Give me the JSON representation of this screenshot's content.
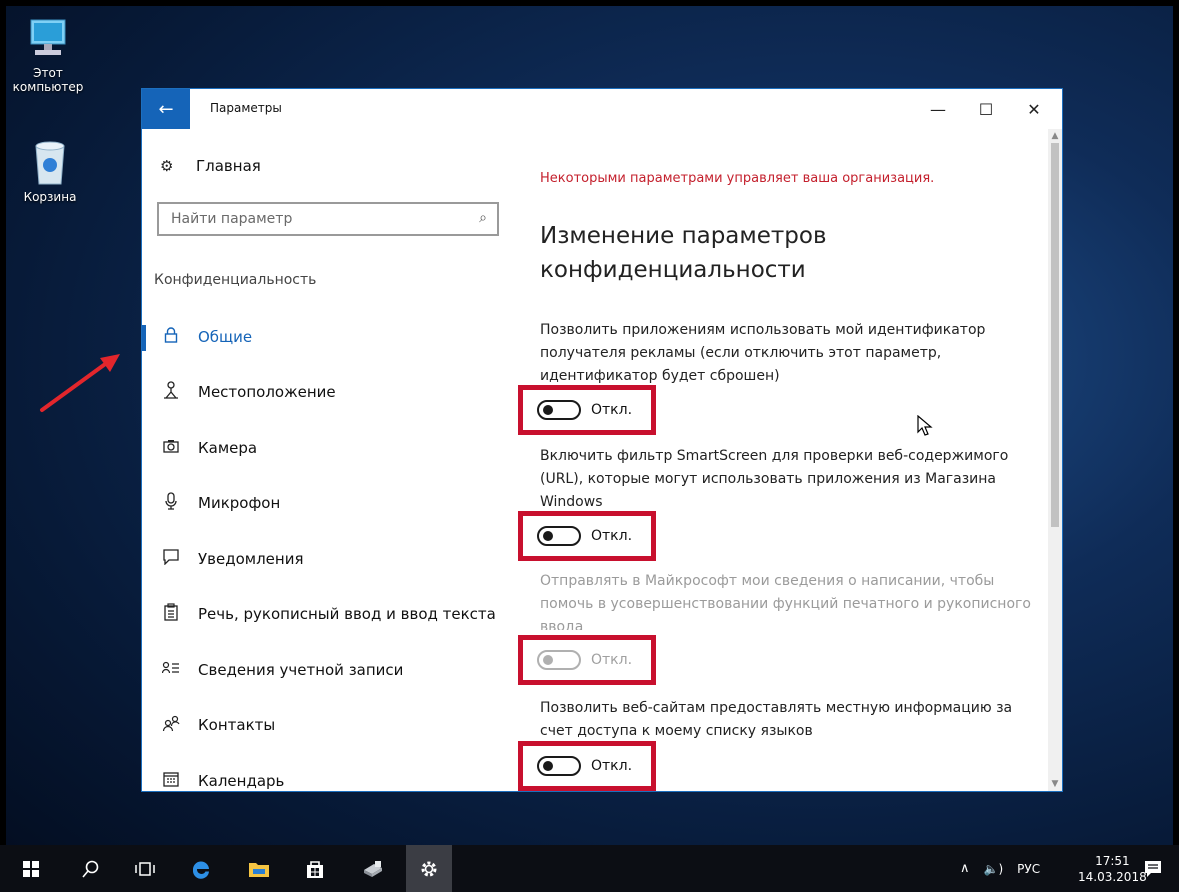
{
  "desktop": {
    "icons": [
      {
        "label": "Этот компьютер",
        "icon": "computer-icon"
      },
      {
        "label": "Корзина",
        "icon": "recycle-bin-icon"
      }
    ]
  },
  "window": {
    "title": "Параметры",
    "back_icon": "←",
    "minimize_icon": "—",
    "maximize_icon": "☐",
    "close_icon": "✕"
  },
  "sidebar": {
    "home_label": "Главная",
    "home_icon": "⚙",
    "search_placeholder": "Найти параметр",
    "search_icon": "⌕",
    "section_title": "Конфиденциальность",
    "items": [
      {
        "label": "Общие",
        "icon": "lock-icon",
        "glyph": "🔒",
        "active": true
      },
      {
        "label": "Местоположение",
        "icon": "location-icon",
        "glyph": "♗"
      },
      {
        "label": "Камера",
        "icon": "camera-icon",
        "glyph": "◙"
      },
      {
        "label": "Микрофон",
        "icon": "microphone-icon",
        "glyph": "🎙"
      },
      {
        "label": "Уведомления",
        "icon": "notifications-icon",
        "glyph": "▭"
      },
      {
        "label": "Речь, рукописный ввод и ввод текста",
        "icon": "speech-icon",
        "glyph": "▤"
      },
      {
        "label": "Сведения учетной записи",
        "icon": "account-info-icon",
        "glyph": "ᴙ≡"
      },
      {
        "label": "Контакты",
        "icon": "contacts-icon",
        "glyph": "ℛ"
      },
      {
        "label": "Календарь",
        "icon": "calendar-icon",
        "glyph": "▦"
      }
    ]
  },
  "content": {
    "org_note": "Некоторыми параметрами управляет ваша организация.",
    "heading": "Изменение параметров конфиденциальности",
    "options": [
      {
        "description": "Позволить приложениям использовать мой идентификатор получателя рекламы (если отключить этот параметр, идентификатор будет сброшен)",
        "state_label": "Откл.",
        "disabled": false
      },
      {
        "description": "Включить фильтр SmartScreen для проверки веб-содержимого (URL), которые могут использовать приложения из Магазина Windows",
        "state_label": "Откл.",
        "disabled": false
      },
      {
        "description": "Отправлять в Майкрософт мои сведения о написании, чтобы помочь в усовершенствовании функций печатного и рукописного ввода",
        "state_label": "Откл.",
        "disabled": true
      },
      {
        "description": "Позволить веб-сайтам предоставлять местную информацию за счет доступа к моему списку языков",
        "state_label": "Откл.",
        "disabled": false
      }
    ]
  },
  "taskbar": {
    "buttons": [
      {
        "name": "start-button",
        "icon": "windows-logo-icon",
        "glyph": "⊞"
      },
      {
        "name": "search-button",
        "icon": "search-icon",
        "glyph": "⚲"
      },
      {
        "name": "task-view-button",
        "icon": "task-view-icon",
        "glyph": "⧉"
      },
      {
        "name": "edge-button",
        "icon": "edge-icon",
        "glyph": "e"
      },
      {
        "name": "file-explorer-button",
        "icon": "folder-icon",
        "glyph": "▰"
      },
      {
        "name": "store-button",
        "icon": "store-icon",
        "glyph": "⊠"
      },
      {
        "name": "app-button",
        "icon": "network-drive-icon",
        "glyph": "⛁"
      },
      {
        "name": "settings-button",
        "icon": "gear-icon",
        "glyph": "⚙",
        "active": true
      }
    ],
    "tray": {
      "chevron": "∧",
      "volume": "🔈)",
      "language": "РУС"
    },
    "time": "17:51",
    "date": "14.03.2018",
    "notifications_icon": "action-center-icon"
  },
  "colors": {
    "accent": "#1564b8",
    "warning": "#c4202d",
    "highlight_box": "#c8102e"
  }
}
